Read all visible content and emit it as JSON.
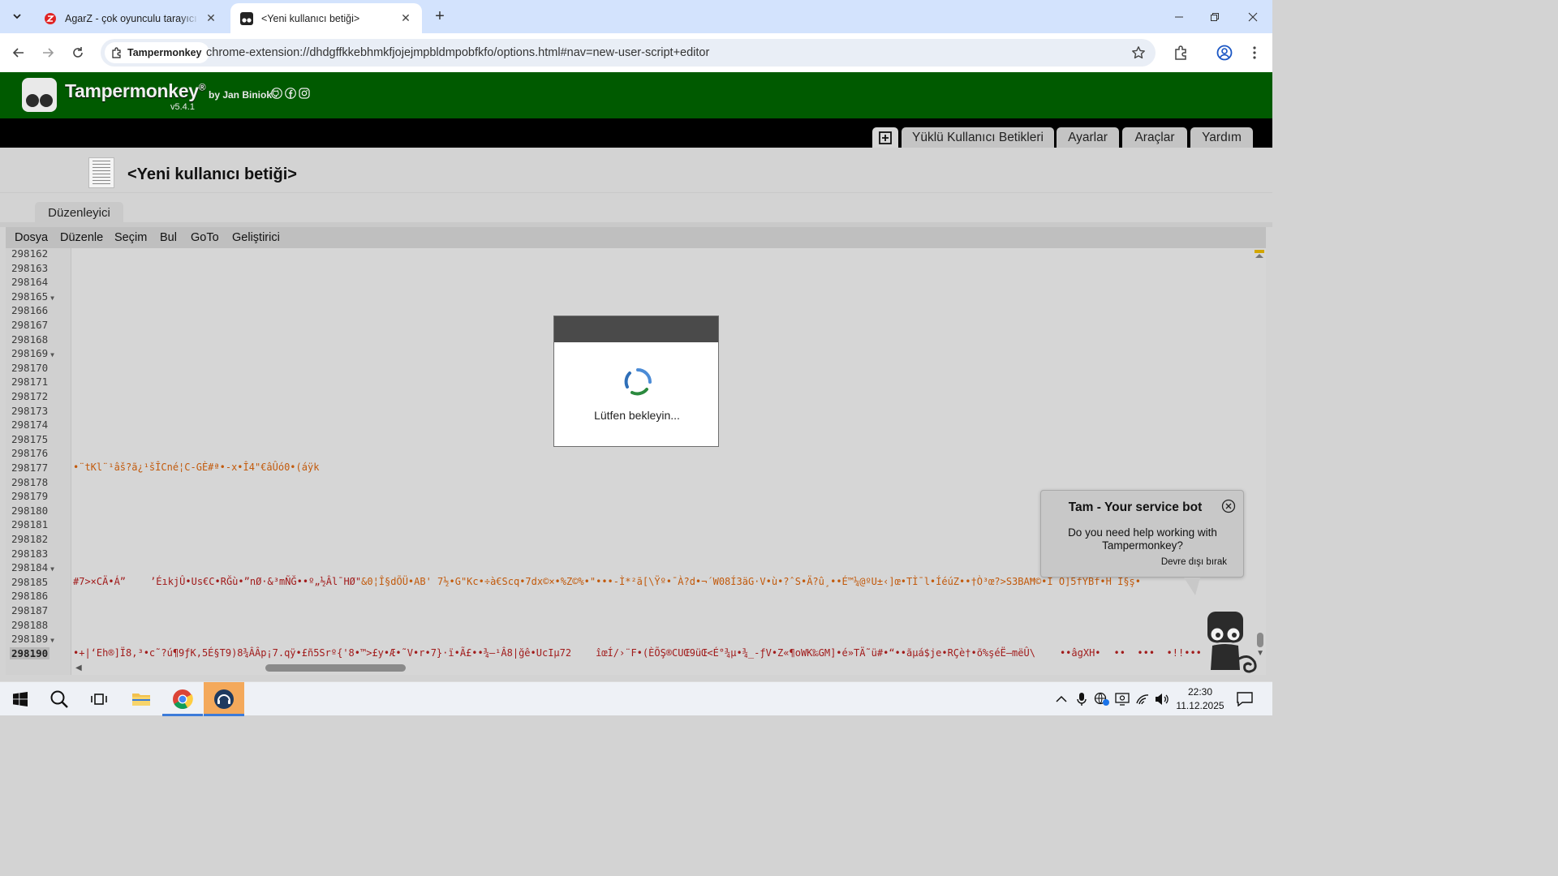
{
  "browser": {
    "tabs": [
      {
        "title": "AgarZ - çok oyunculu tarayıcı oyunu",
        "active": false
      },
      {
        "title": "<Yeni kullanıcı betiği>",
        "active": true
      }
    ],
    "site_chip": "Tampermonkey",
    "url": "chrome-extension://dhdgffkkebhmkfjojejmpbldmpobfkfo/options.html#nav=new-user-script+editor"
  },
  "tampermonkey": {
    "name": "Tampermonkey",
    "registered": "®",
    "by": "by Jan Biniok",
    "version": "v5.4.1",
    "nav": {
      "installed": "Yüklü Kullanıcı Betikleri",
      "settings": "Ayarlar",
      "tools": "Araçlar",
      "help": "Yardım"
    }
  },
  "page": {
    "script_title": "<Yeni kullanıcı betiği>",
    "editor_tab": "Düzenleyici"
  },
  "menu": [
    "Dosya",
    "Düzenle",
    "Seçim",
    "Bul",
    "GoTo",
    "Geliştirici"
  ],
  "editor": {
    "lines": [
      {
        "n": "298162"
      },
      {
        "n": "298163"
      },
      {
        "n": "298164"
      },
      {
        "n": "298165",
        "fold": true
      },
      {
        "n": "298166"
      },
      {
        "n": "298167"
      },
      {
        "n": "298168"
      },
      {
        "n": "298169",
        "fold": true
      },
      {
        "n": "298170"
      },
      {
        "n": "298171"
      },
      {
        "n": "298172"
      },
      {
        "n": "298173"
      },
      {
        "n": "298174"
      },
      {
        "n": "298175"
      },
      {
        "n": "298176"
      },
      {
        "n": "298177"
      },
      {
        "n": "298178"
      },
      {
        "n": "298179"
      },
      {
        "n": "298180"
      },
      {
        "n": "298181"
      },
      {
        "n": "298182"
      },
      {
        "n": "298183"
      },
      {
        "n": "298184",
        "fold": true
      },
      {
        "n": "298185"
      },
      {
        "n": "298186"
      },
      {
        "n": "298187"
      },
      {
        "n": "298188"
      },
      {
        "n": "298189",
        "fold": true
      },
      {
        "n": "298190",
        "current": true
      }
    ],
    "code_298177": "•¨tKl¨¹âš?ã¿¹šÎCné¦C-GÈ#ª•-x•Î4\"€âÛó0•(áÿk",
    "code_298185_a": "#7>×CÄ•Á”",
    "code_298185_b": "’ÉıkjÛ•Us€C•RĞù•”nØ·&³mÑĞ••º„½Âl¯HØ\"",
    "code_298185_c": "&0¦Î§dÕÜ•AB' 7½•G\"Kc•÷à€Scq•7dx©×•%Z©%•\"•••-Ì*²ã[\\Ÿº•¯À?d•¬´W08Í3äG·V•ù•?ˆS•Ä?û¸••É™¼@ºU±‹]œ•TÌ¯l•ÍéúZ••†Ò³œ?>S3BAĦ©•I O]5fYBf•H Ï§ş•",
    "code_298190_a": "•+|‘Eh®]Ï8,³•c˜?ú¶9ƒK,5É§T9)8¾ÂÂp¡7.qÿ•£ñ5Srº{'8•™>£y•Æ•˜V•r•7}·ï•Ã£••¾–¹Â8|ğê•UcIµ72",
    "code_298190_b": "îœÍ/›¨F•(ÈÕŞ®CUŒ9üŒ<É°¾µ•¾_-ƒV•Z«¶oWK‰GM]•é»TÄ˜ü#•“••ãµá$je•RÇè†•õ%şéË–mëÛ\\",
    "code_298190_c": "••âgXH•",
    "code_298190_d": "••  •••  •!!•••"
  },
  "loading": {
    "text": "Lütfen bekleyin..."
  },
  "bot": {
    "title": "Tam - Your service bot",
    "message": "Do you need help working with Tampermonkey?",
    "disable": "Devre dışı bırak"
  },
  "taskbar": {
    "time": "22:30",
    "date": "11.12.2025"
  },
  "colors": {
    "tm_green": "#005a00",
    "tab_strip": "#d3e3fd",
    "code_orange": "#c25a0c",
    "code_red": "#a11b1b"
  }
}
